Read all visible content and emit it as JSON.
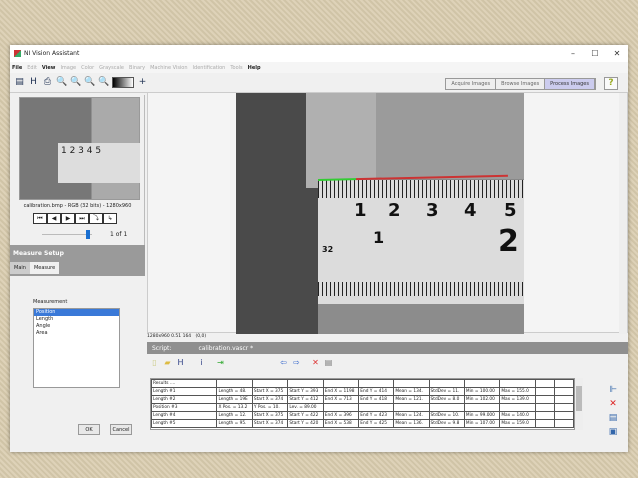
{
  "window": {
    "title": "NI Vision Assistant",
    "controls": [
      "–",
      "☐",
      "✕"
    ]
  },
  "menu": [
    {
      "label": "File",
      "enabled": true
    },
    {
      "label": "Edit",
      "enabled": false
    },
    {
      "label": "View",
      "enabled": true
    },
    {
      "label": "Image",
      "enabled": false
    },
    {
      "label": "Color",
      "enabled": false
    },
    {
      "label": "Grayscale",
      "enabled": false
    },
    {
      "label": "Binary",
      "enabled": false
    },
    {
      "label": "Machine Vision",
      "enabled": false
    },
    {
      "label": "Identification",
      "enabled": false
    },
    {
      "label": "Tools",
      "enabled": false
    },
    {
      "label": "Help",
      "enabled": true
    }
  ],
  "modes": {
    "acquire": "Acquire Images",
    "browse": "Browse Images",
    "process": "Process Images",
    "help": "?"
  },
  "browser": {
    "filename": "calibration.bmp - RGB (32 bits) - 1280x960",
    "page": "1",
    "of": "of",
    "total": "1",
    "nav": [
      "⏮",
      "◀",
      "▶",
      "⏭",
      "⤵",
      "↳"
    ]
  },
  "setup": {
    "title": "Measure Setup",
    "tabs": [
      "Main",
      "Measure"
    ],
    "measurement_label": "Measurement",
    "options": [
      "Position",
      "Length",
      "Angle",
      "Area"
    ],
    "selected": "Position",
    "ok": "OK",
    "cancel": "Cancel"
  },
  "image": {
    "ruler_numbers": [
      "1",
      "2",
      "3",
      "4",
      "5"
    ],
    "ruler_lower": [
      "1",
      "2"
    ],
    "small": "32"
  },
  "status": {
    "info": "1280x960 0.51 164",
    "coord": "(0,0)"
  },
  "script": {
    "label": "Script:",
    "name": "calibration.vascr *"
  },
  "results": {
    "header": "Results ....",
    "rows": [
      [
        "Length #1",
        "Length = 48.",
        "Start X = 375",
        "Start Y = 393",
        "End X = 1198",
        "End Y = 414",
        "Mean = 134.",
        "StdDev = 11.",
        "Min = 100.00",
        "Max = 155.0"
      ],
      [
        "Length #2",
        "Length = 19E",
        "Start X = 374",
        "Start Y = 412",
        "End X = 713",
        "End Y = 418",
        "Mean = 121.",
        "StdDev = 8.0",
        "Min = 102.00",
        "Max = 139.0"
      ],
      [
        "Position #3",
        "X Pos. = 13.2",
        "Y Pos. = 10.",
        "Lev. = 89.00",
        "",
        "",
        "",
        "",
        "",
        ""
      ],
      [
        "Length #4",
        "Length = 12.",
        "Start X = 375",
        "Start Y = 422",
        "End X = 396",
        "End Y = 423",
        "Mean = 124.",
        "StdDev = 10.",
        "Min = 99.000",
        "Max = 140.0"
      ],
      [
        "Length #5",
        "Length = 95.",
        "Start X = 374",
        "Start Y = 420",
        "End X = 538",
        "End Y = 425",
        "Mean = 136.",
        "StdDev = 9.8",
        "Min = 107.00",
        "Max = 159.0"
      ]
    ]
  }
}
